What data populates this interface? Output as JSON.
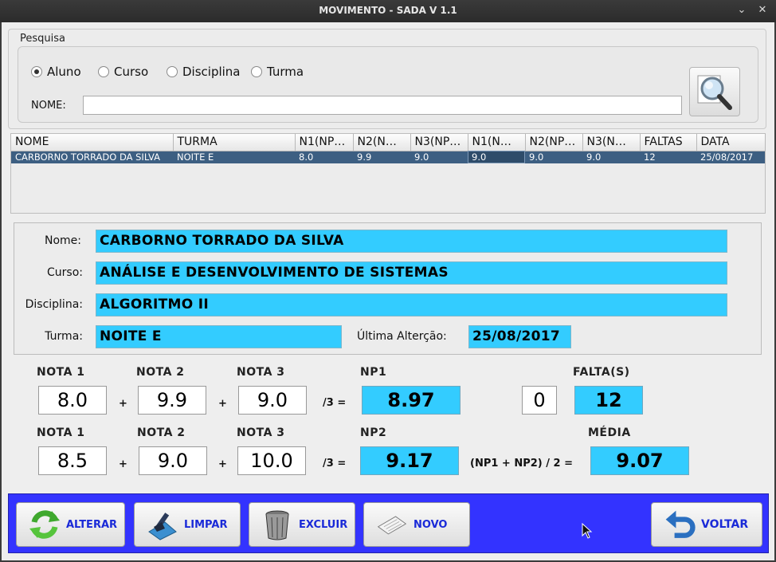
{
  "window": {
    "title": "MOVIMENTO - SADA V 1.1",
    "minimize_glyph": "⌄",
    "close_glyph": "✕"
  },
  "search": {
    "legend": "Pesquisa",
    "options": [
      {
        "label": "Aluno",
        "checked": true
      },
      {
        "label": "Curso",
        "checked": false
      },
      {
        "label": "Disciplina",
        "checked": false
      },
      {
        "label": "Turma",
        "checked": false
      }
    ],
    "name_label": "NOME:",
    "name_value": "",
    "button_icon": "magnifier-icon"
  },
  "table": {
    "headers": [
      "NOME",
      "TURMA",
      "N1(NP…",
      "N2(N…",
      "N3(NP…",
      "N1(N…",
      "N2(NP…",
      "N3(N…",
      "FALTAS",
      "DATA"
    ],
    "rows": [
      [
        "CARBORNO TORRADO DA SILVA",
        "NOITE E",
        "8.0",
        "9.9",
        "9.0",
        "9.0",
        "9.0",
        "9.0",
        "12",
        "25/08/2017"
      ]
    ]
  },
  "details": {
    "nome_label": "Nome:",
    "nome_value": "CARBORNO TORRADO DA SILVA",
    "curso_label": "Curso:",
    "curso_value": "ANÁLISE E DESENVOLVIMENTO DE SISTEMAS",
    "disciplina_label": "Disciplina:",
    "disciplina_value": "ALGORITMO II",
    "turma_label": "Turma:",
    "turma_value": "NOITE E",
    "ultima_label": "Última Alterção:",
    "ultima_value": "25/08/2017"
  },
  "grades": {
    "row1": {
      "n1_label": "NOTA 1",
      "n2_label": "NOTA 2",
      "n3_label": "NOTA 3",
      "n1": "8.0",
      "n2": "9.9",
      "n3": "9.0",
      "result_label": "NP1",
      "result": "8.97"
    },
    "row2": {
      "n1_label": "NOTA 1",
      "n2_label": "NOTA 2",
      "n3_label": "NOTA 3",
      "n1": "8.5",
      "n2": "9.0",
      "n3": "10.0",
      "result_label": "NP2",
      "result": "9.17"
    },
    "plus": "+",
    "div3": "/3 =",
    "faltas_label": "FALTA(S)",
    "faltas_input": "0",
    "faltas_total": "12",
    "media_formula": "(NP1 + NP2) / 2 =",
    "media_label": "MÉDIA",
    "media": "9.07"
  },
  "actions": {
    "alterar": "ALTERAR",
    "limpar": "LIMPAR",
    "excluir": "EXCLUIR",
    "novo": "NOVO",
    "voltar": "VOLTAR"
  },
  "colors": {
    "field_bg": "#33ccff",
    "action_bar": "#3333ff",
    "table_selected": "#3d5f82",
    "button_text": "#1a2ad8"
  }
}
